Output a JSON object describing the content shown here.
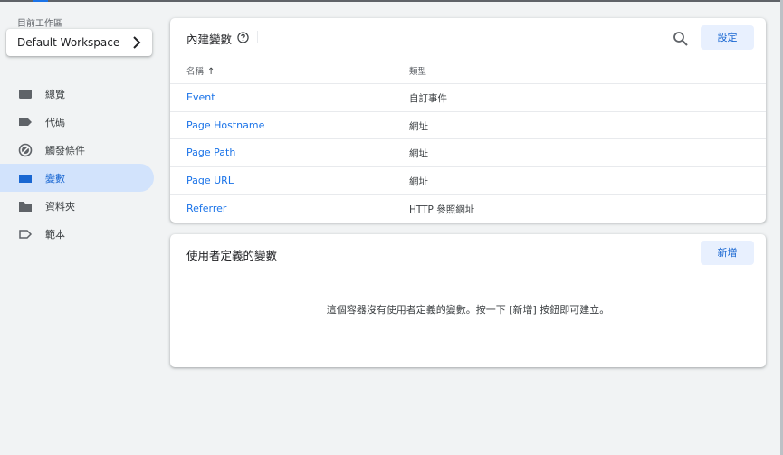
{
  "sidebar": {
    "workspace_label": "目前工作區",
    "workspace_name": "Default Workspace",
    "items": [
      {
        "label": "總覽",
        "icon": "overview-icon"
      },
      {
        "label": "代碼",
        "icon": "tag-icon"
      },
      {
        "label": "觸發條件",
        "icon": "trigger-icon"
      },
      {
        "label": "變數",
        "icon": "variables-icon",
        "active": true
      },
      {
        "label": "資料夾",
        "icon": "folder-icon"
      },
      {
        "label": "範本",
        "icon": "template-icon"
      }
    ]
  },
  "builtin": {
    "title": "內建變數",
    "settings_label": "設定",
    "col_name": "名稱",
    "col_type": "類型",
    "rows": [
      {
        "name": "Event",
        "type": "自訂事件"
      },
      {
        "name": "Page Hostname",
        "type": "網址"
      },
      {
        "name": "Page Path",
        "type": "網址"
      },
      {
        "name": "Page URL",
        "type": "網址"
      },
      {
        "name": "Referrer",
        "type": "HTTP 參照網址"
      }
    ]
  },
  "user_defined": {
    "title": "使用者定義的變數",
    "new_label": "新增",
    "empty_message": "這個容器沒有使用者定義的變數。按一下 [新增] 按鈕即可建立。"
  },
  "colors": {
    "accent": "#1a73e8",
    "active_bg": "#d2e3fc",
    "button_bg": "#e8f0fe"
  }
}
